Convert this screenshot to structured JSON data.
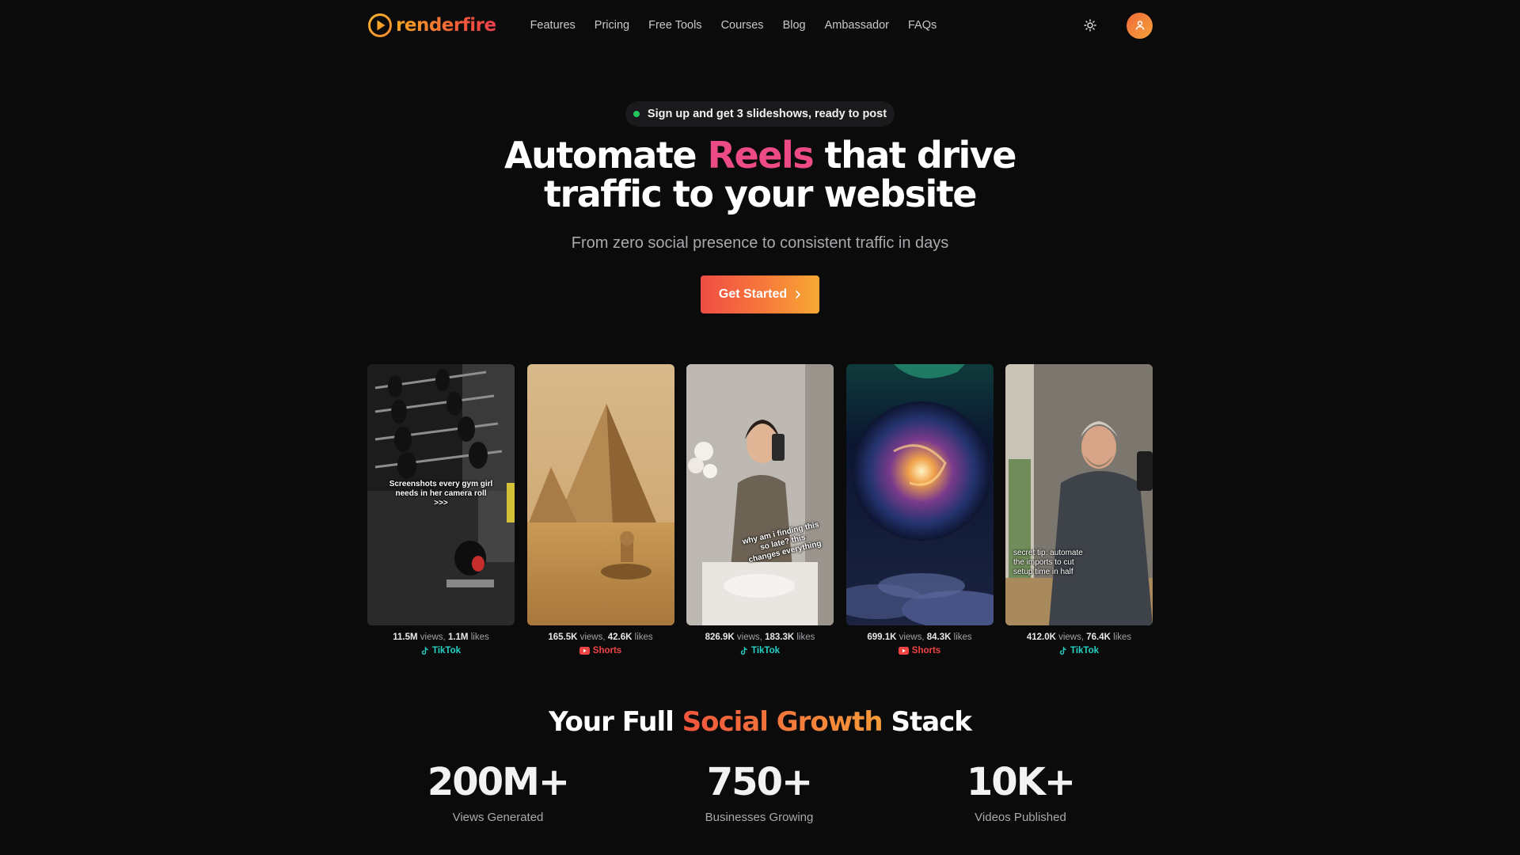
{
  "brand": {
    "name": "renderfire"
  },
  "nav": {
    "links": [
      "Features",
      "Pricing",
      "Free Tools",
      "Courses",
      "Blog",
      "Ambassador",
      "FAQs"
    ],
    "theme_toggle_icon": "sun-icon",
    "account_icon": "user-icon"
  },
  "hero": {
    "badge": "Sign up and get 3 slideshows, ready to post",
    "headline_pre": "Automate ",
    "headline_accent": "Reels",
    "headline_post": " that drive traffic to your website",
    "subtitle": "From zero social presence to consistent traffic in days",
    "cta": "Get Started"
  },
  "cards": [
    {
      "caption": "Screenshots every gym girl needs in her camera roll >>>",
      "views": "11.5M",
      "likes": "1.1M",
      "platform": "TikTok"
    },
    {
      "caption": "",
      "views": "165.5K",
      "likes": "42.6K",
      "platform": "Shorts"
    },
    {
      "caption": "why am i finding this so late? this changes everything",
      "views": "826.9K",
      "likes": "183.3K",
      "platform": "TikTok"
    },
    {
      "caption": "",
      "views": "699.1K",
      "likes": "84.3K",
      "platform": "Shorts"
    },
    {
      "caption": "secret tip: automate the imports to cut setup time in half",
      "views": "412.0K",
      "likes": "76.4K",
      "platform": "TikTok"
    }
  ],
  "labels": {
    "views": "views",
    "likes": "likes"
  },
  "stack": {
    "title_pre": "Your Full ",
    "title_accent": "Social Growth",
    "title_post": " Stack",
    "metrics": [
      {
        "value": "200M+",
        "label": "Views Generated"
      },
      {
        "value": "750+",
        "label": "Businesses Growing"
      },
      {
        "value": "10K+",
        "label": "Videos Published"
      }
    ]
  },
  "colors": {
    "background": "#0b0b0c",
    "accent_pink": "#ec4b86",
    "accent_orange": "#f77a3a",
    "tiktok": "#22d3c5",
    "shorts": "#ef4444",
    "badge_dot": "#22c55e"
  }
}
